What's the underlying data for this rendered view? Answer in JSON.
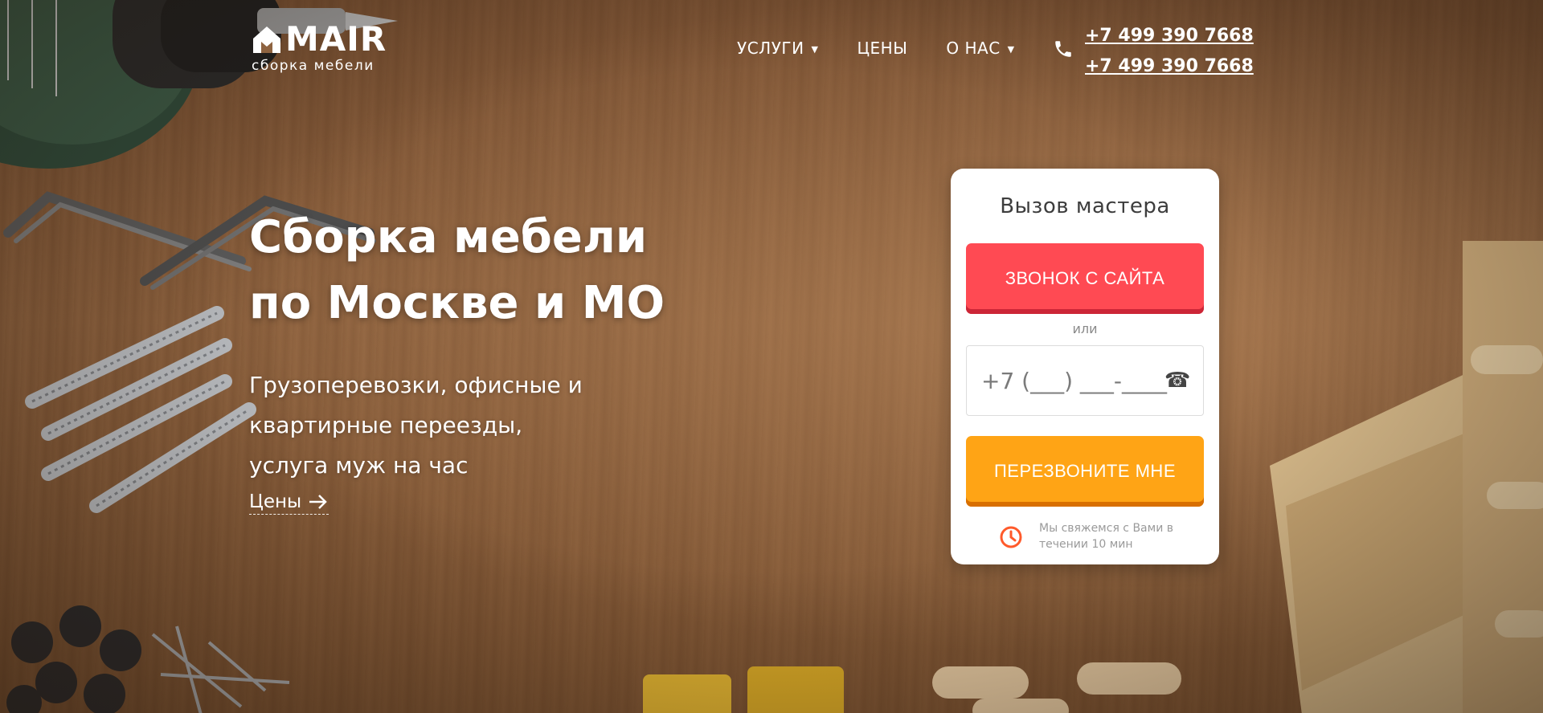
{
  "logo": {
    "name": "MAIR",
    "tagline": "сборка мебели"
  },
  "nav": {
    "items": [
      {
        "label": "УСЛУГИ",
        "dropdown": true
      },
      {
        "label": "ЦЕНЫ",
        "dropdown": false
      },
      {
        "label": "О НАС",
        "dropdown": true
      }
    ],
    "caret": "▼"
  },
  "header": {
    "phones": [
      "+7 499 390 7668",
      "+7 499 390 7668"
    ]
  },
  "hero": {
    "title_lines": [
      "Сборка мебели",
      "по Москве и МО"
    ],
    "subtitle_lines": [
      "Грузоперевозки, офисные и",
      "квартирные переезды,",
      "услуга муж на час"
    ],
    "link_label": "Цены"
  },
  "form": {
    "title": "Вызов мастера",
    "call_button": "ЗВОНОК С САЙТА",
    "or_text": "или",
    "phone_placeholder": "+7 (___) ___-____",
    "phone_glyph": "☎",
    "submit_button": "ПЕРЕЗВОНИТЕ МНЕ",
    "note_lines": [
      "Мы свяжемся с Вами в",
      "течении 10 мин"
    ]
  },
  "colors": {
    "red_button": "#ff4a53",
    "orange_button": "#ffa415",
    "clock_icon": "#ff5a2b",
    "background_wood": "#8e6340"
  },
  "icons": [
    "house-logo-icon",
    "phone-icon",
    "arrow-right-icon",
    "clock-icon",
    "telephone-icon"
  ]
}
